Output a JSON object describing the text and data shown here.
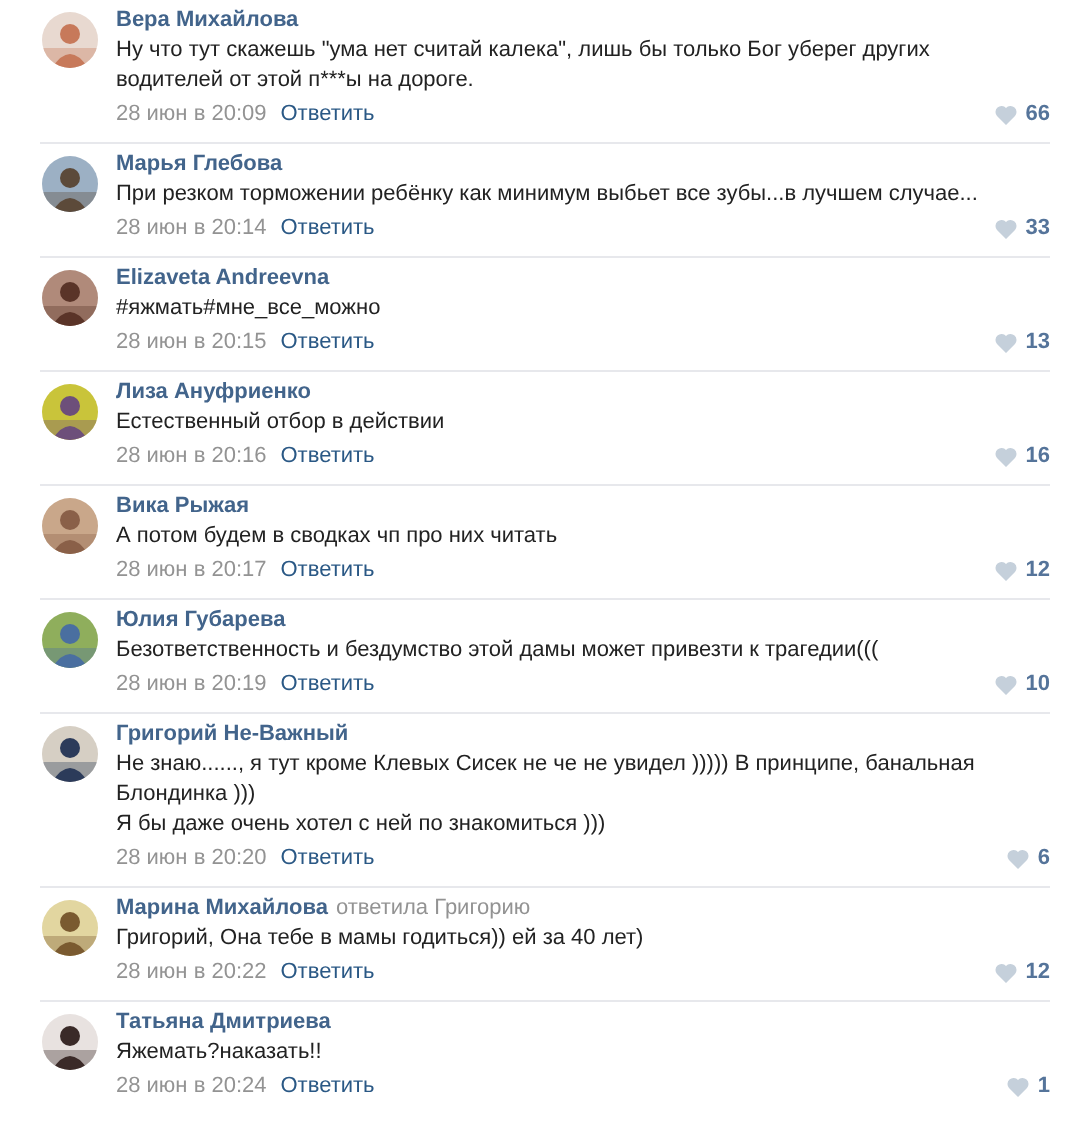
{
  "comments": [
    {
      "author": "Вера Михайлова",
      "paragraphs": [
        "Ну что тут скажешь \"ума нет считай калека\", лишь бы только Бог уберег других водителей от этой п***ы на дороге."
      ],
      "date": "28 июн в 20:09",
      "reply": "Ответить",
      "likes": "66"
    },
    {
      "author": "Марья Глебова",
      "paragraphs": [
        "При резком торможении ребёнку как минимум выбьет все зубы...в лучшем случае..."
      ],
      "date": "28 июн в 20:14",
      "reply": "Ответить",
      "likes": "33"
    },
    {
      "author": "Elizaveta Andreevna",
      "paragraphs": [
        "#яжмать#мне_все_можно"
      ],
      "date": "28 июн в 20:15",
      "reply": "Ответить",
      "likes": "13"
    },
    {
      "author": "Лиза Ануфриенко",
      "paragraphs": [
        "Естественный отбор в действии"
      ],
      "date": "28 июн в 20:16",
      "reply": "Ответить",
      "likes": "16"
    },
    {
      "author": "Вика Рыжая",
      "paragraphs": [
        "А потом будем в сводках чп про них читать"
      ],
      "date": "28 июн в 20:17",
      "reply": "Ответить",
      "likes": "12"
    },
    {
      "author": "Юлия Губарева",
      "paragraphs": [
        "Безответственность и бездумство этой дамы может привезти к трагедии((("
      ],
      "date": "28 июн в 20:19",
      "reply": "Ответить",
      "likes": "10"
    },
    {
      "author": "Григорий Не-Важный",
      "paragraphs": [
        "Не знаю......, я тут кроме Клевых Сисек не че не увидел ))))) В принципе, банальная Блондинка )))",
        "Я бы даже очень хотел с ней по знакомиться )))"
      ],
      "date": "28 июн в 20:20",
      "reply": "Ответить",
      "likes": "6"
    },
    {
      "author": "Марина Михайлова",
      "reply_to": "ответила Григорию",
      "paragraphs": [
        "Григорий, Она тебе в мамы годиться)) ей за 40 лет)"
      ],
      "date": "28 июн в 20:22",
      "reply": "Ответить",
      "likes": "12"
    },
    {
      "author": "Татьяна Дмитриева",
      "paragraphs": [
        "Яжемать?наказать!!"
      ],
      "date": "28 июн в 20:24",
      "reply": "Ответить",
      "likes": "1"
    }
  ]
}
